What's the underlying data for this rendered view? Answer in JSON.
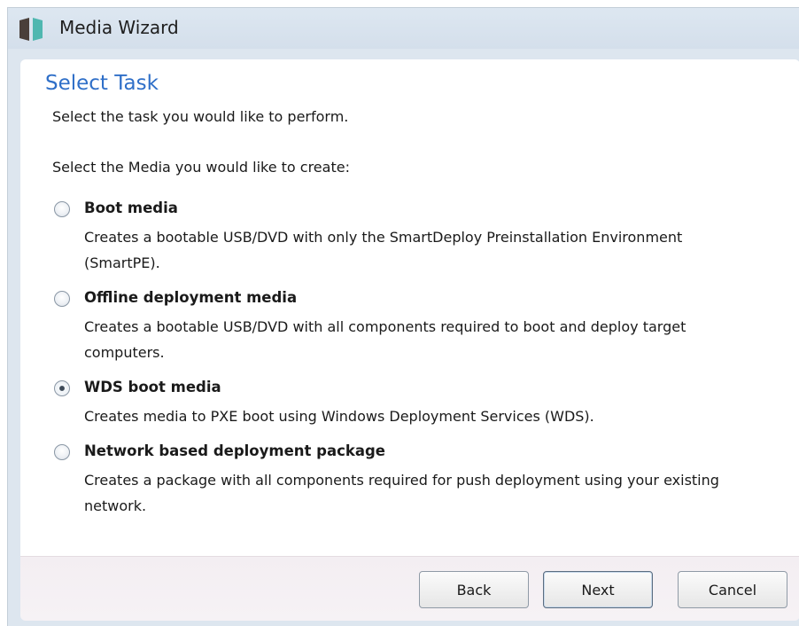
{
  "window": {
    "title": "Media Wizard",
    "app_icon": "smartdeploy-logo-icon"
  },
  "page": {
    "heading": "Select Task",
    "subtitle": "Select the task you would like to perform.",
    "prompt": "Select the Media you would like to create:"
  },
  "options": [
    {
      "label": "Boot media",
      "description": "Creates a bootable USB/DVD with only the SmartDeploy Preinstallation Environment (SmartPE).",
      "selected": false
    },
    {
      "label": "Offline deployment media",
      "description": "Creates a bootable USB/DVD with all components required to boot and deploy target computers.",
      "selected": false
    },
    {
      "label": "WDS boot media",
      "description": "Creates media to PXE boot using Windows Deployment Services (WDS).",
      "selected": true
    },
    {
      "label": "Network based deployment package",
      "description": "Creates a package with all components required for push deployment using your existing network.",
      "selected": false
    }
  ],
  "buttons": {
    "back": "Back",
    "next": "Next",
    "cancel": "Cancel"
  },
  "colors": {
    "heading": "#2f6fc8",
    "titlebar": "#dde7f1",
    "logo_dark": "#4a3f3a",
    "logo_teal": "#4fb7b0"
  }
}
